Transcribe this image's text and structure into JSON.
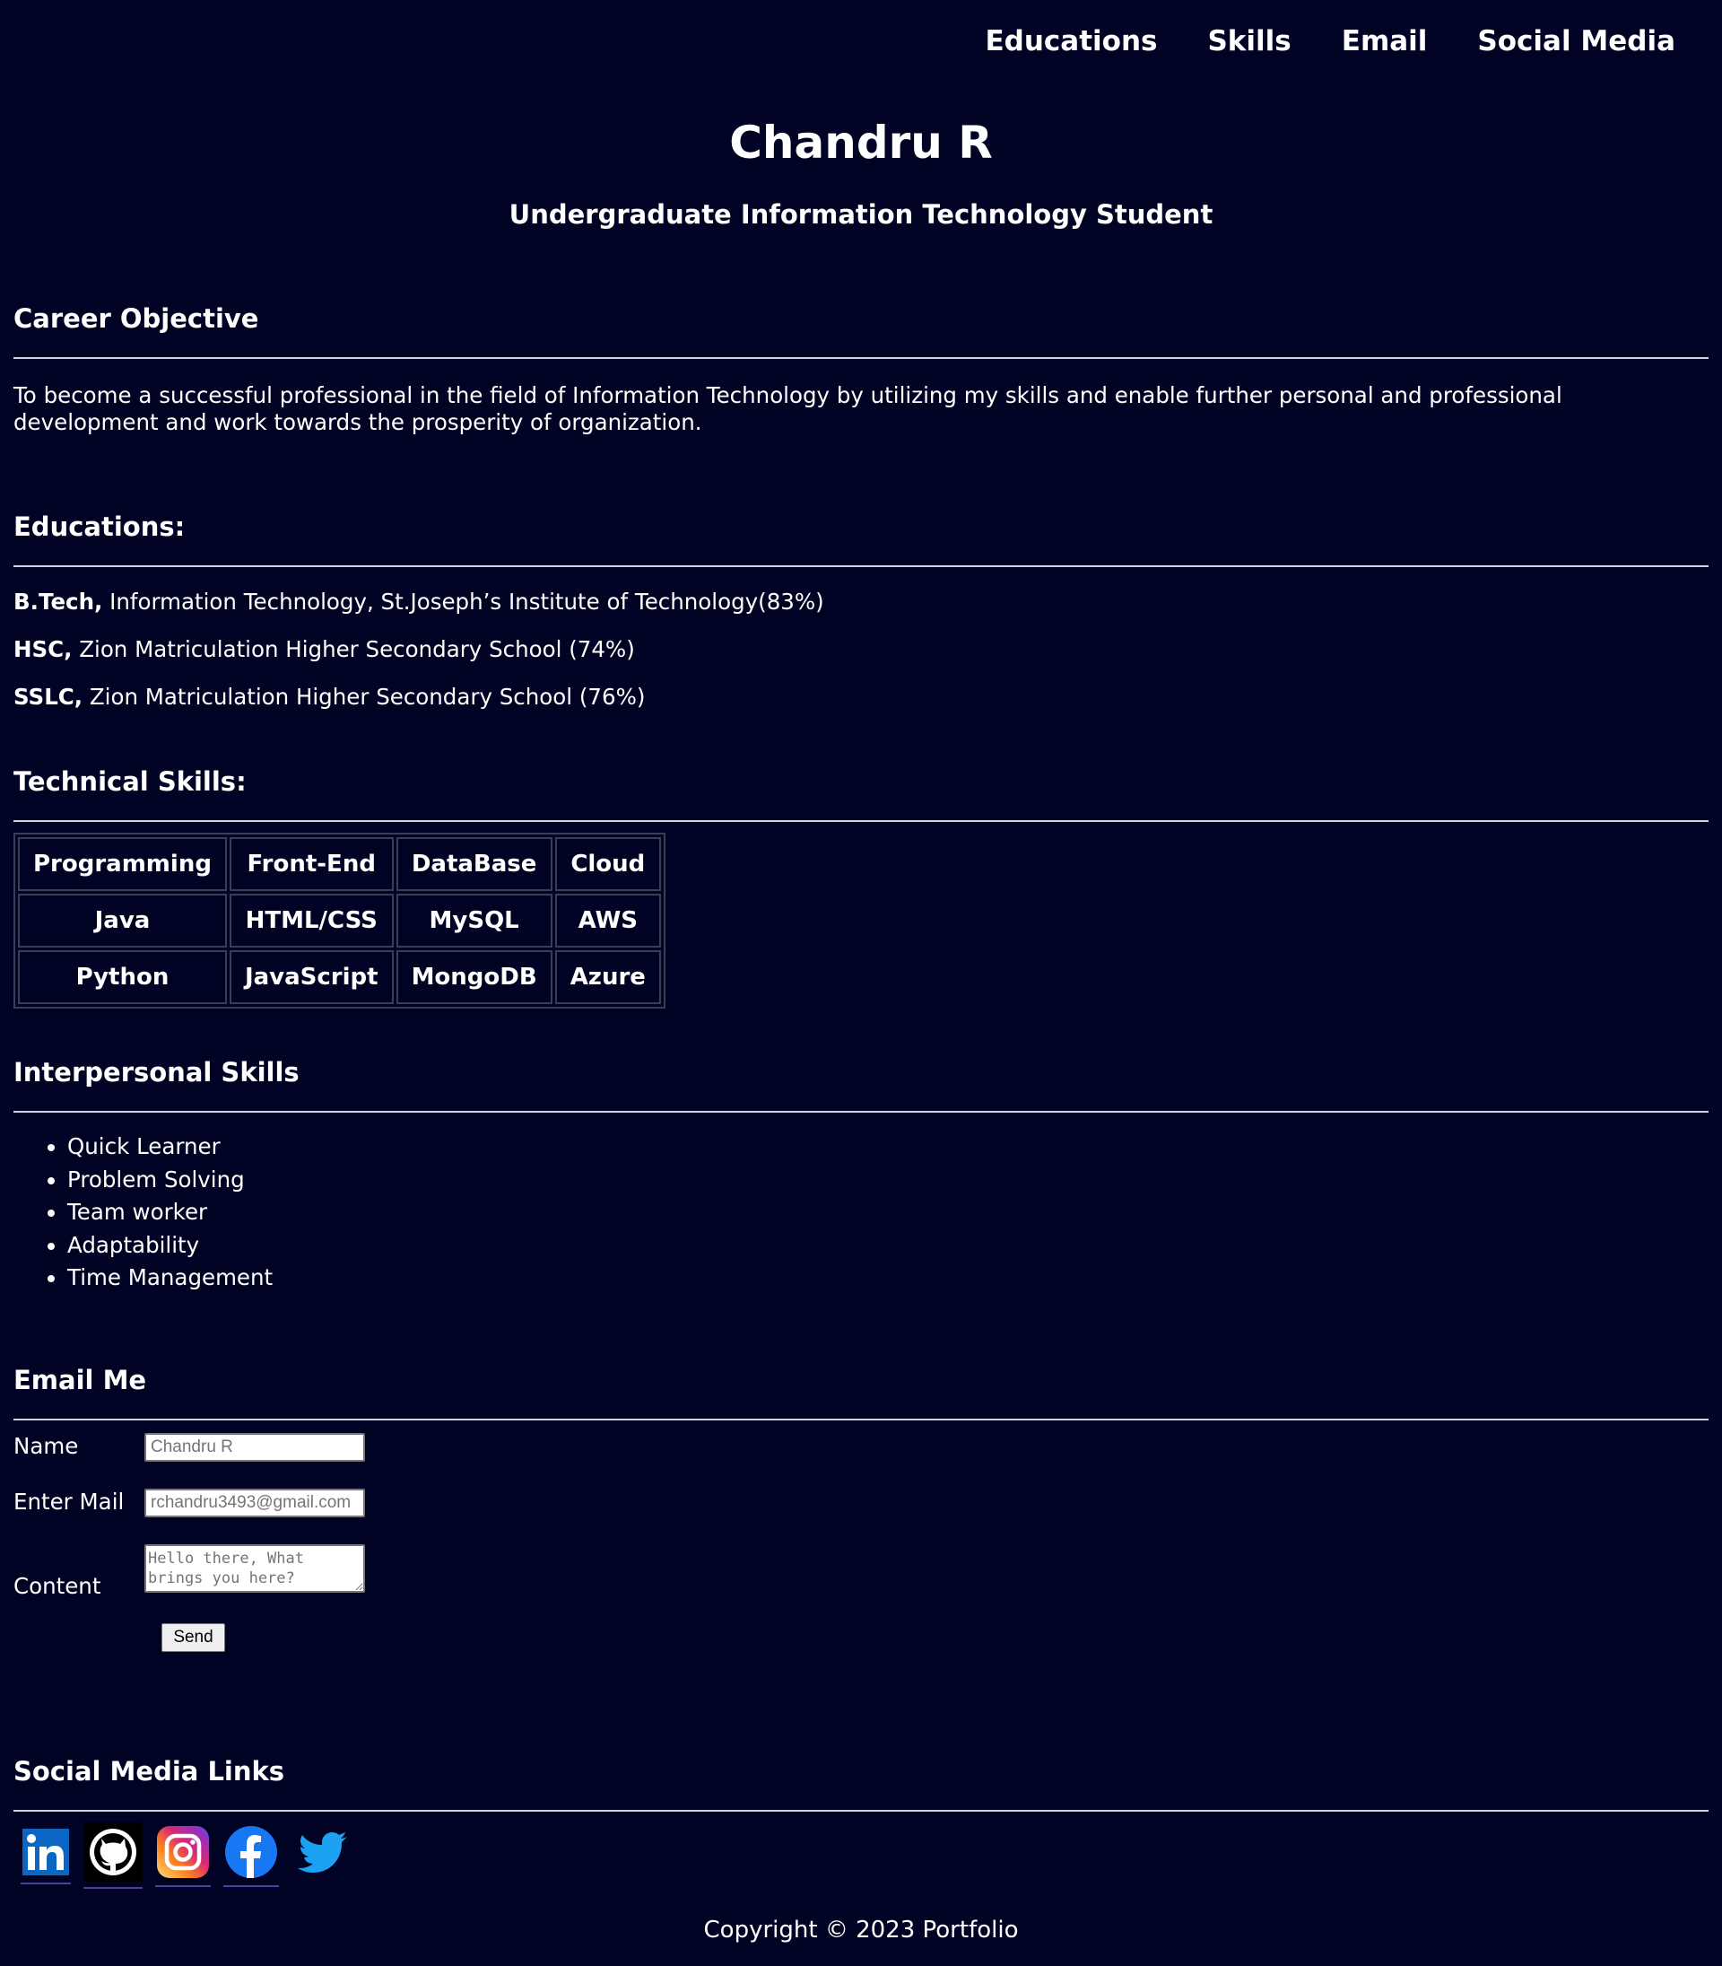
{
  "nav": {
    "educations": "Educations",
    "skills": "Skills",
    "email": "Email",
    "social": "Social Media"
  },
  "hero": {
    "name": "Chandru R",
    "title": "Undergraduate Information Technology Student"
  },
  "career": {
    "heading": "Career Objective",
    "text": "To become a successful professional in the field of Information Technology by utilizing my skills and enable further personal and professional development and work towards the prosperity of organization."
  },
  "education": {
    "heading": "Educations:",
    "items": [
      {
        "degree": "B.Tech,",
        "detail": " Information Technology, St.Joseph’s Institute of Technology(83%)"
      },
      {
        "degree": "HSC,",
        "detail": " Zion Matriculation Higher Secondary School (74%)"
      },
      {
        "degree": "SSLC,",
        "detail": " Zion Matriculation Higher Secondary School (76%)"
      }
    ]
  },
  "technical": {
    "heading": "Technical Skills:",
    "headers": [
      "Programming",
      "Front-End",
      "DataBase",
      "Cloud"
    ],
    "rows": [
      [
        "Java",
        "HTML/CSS",
        "MySQL",
        "AWS"
      ],
      [
        "Python",
        "JavaScript",
        "MongoDB",
        "Azure"
      ]
    ]
  },
  "interpersonal": {
    "heading": "Interpersonal Skills",
    "items": [
      "Quick Learner",
      "Problem Solving",
      "Team worker",
      "Adaptability",
      "Time Management"
    ]
  },
  "email": {
    "heading": "Email Me",
    "name_label": "Name",
    "name_placeholder": "Chandru R",
    "mail_label": "Enter Mail",
    "mail_placeholder": "rchandru3493@gmail.com",
    "content_label": "Content",
    "content_placeholder": "Hello there, What brings you here?",
    "send_label": "Send"
  },
  "social": {
    "heading": "Social Media Links",
    "icons": [
      "linkedin-icon",
      "github-icon",
      "instagram-icon",
      "facebook-icon",
      "twitter-icon"
    ]
  },
  "footer": {
    "text": "Copyright © 2023 Portfolio"
  }
}
